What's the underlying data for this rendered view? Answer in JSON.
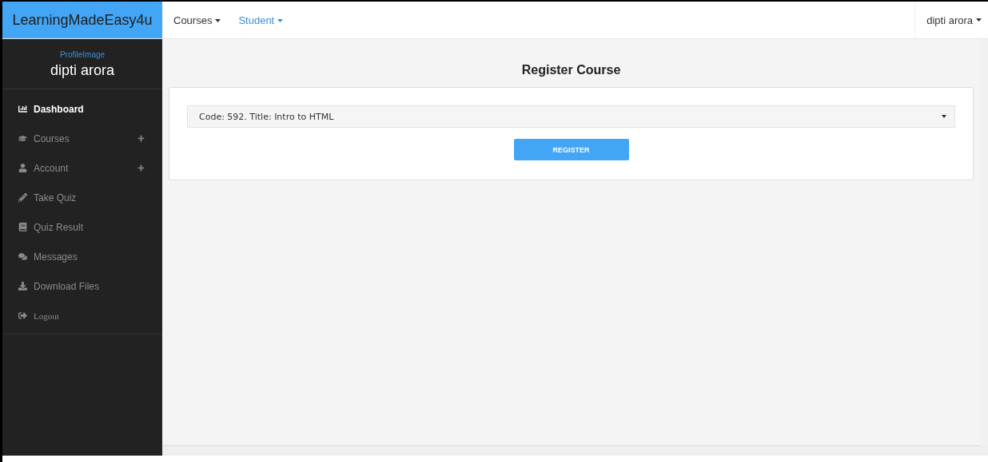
{
  "brand": "LearningMadeEasy4u",
  "nav": [
    {
      "label": "Courses",
      "selected": false
    },
    {
      "label": "Student",
      "selected": true
    }
  ],
  "user_menu": "dipti arora",
  "profile": {
    "image_alt": "ProfileImage",
    "name": "dipti arora"
  },
  "sidebar": {
    "items": [
      {
        "kind": "dashboard",
        "label": "Dashboard",
        "selected": true,
        "expandable": false
      },
      {
        "kind": "courses",
        "label": "Courses",
        "selected": false,
        "expandable": true
      },
      {
        "kind": "account",
        "label": "Account",
        "selected": false,
        "expandable": true
      },
      {
        "kind": "quiz",
        "label": "Take Quiz",
        "selected": false,
        "expandable": false
      },
      {
        "kind": "result",
        "label": "Quiz Result",
        "selected": false,
        "expandable": false
      },
      {
        "kind": "messages",
        "label": "Messages",
        "selected": false,
        "expandable": false
      },
      {
        "kind": "download",
        "label": "Download Files",
        "selected": false,
        "expandable": false
      },
      {
        "kind": "logout",
        "label": "Logout",
        "selected": false,
        "expandable": false
      }
    ]
  },
  "form": {
    "title": "Register Course",
    "course_select": "Code: 592. Title: Intro to HTML",
    "button": "REGISTER"
  }
}
